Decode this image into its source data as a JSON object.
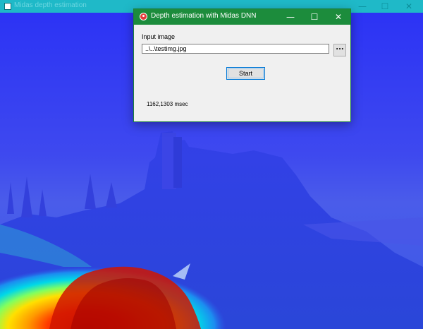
{
  "background_window": {
    "title": "Midas depth estimation",
    "controls": {
      "minimize": "—",
      "maximize": "☐",
      "close": "✕"
    }
  },
  "dialog": {
    "title": "Depth estimation with Midas DNN",
    "controls": {
      "minimize": "—",
      "maximize": "☐",
      "close": "✕"
    },
    "input_label": "Input image",
    "input_value": "..\\..\\testimg.jpg",
    "browse_label": "...",
    "start_label": "Start",
    "timing_text": "1162,1303 msec"
  },
  "colors": {
    "dialog_titlebar": "#1c8c3c",
    "background_titlebar": "#1fb9c8",
    "depth_far": "#2c33f5",
    "depth_near": "#e02a00"
  },
  "icons": {
    "dialog_app_icon": "app-icon",
    "background_app_icon": "app-icon"
  }
}
